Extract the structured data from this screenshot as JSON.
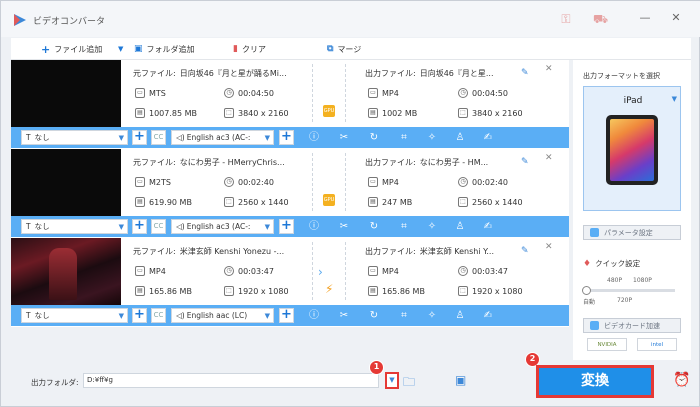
{
  "app": {
    "title": "ビデオコンバータ"
  },
  "toolbar": {
    "add_file": "ファイル追加",
    "add_folder": "フォルダ追加",
    "clear": "クリア",
    "merge": "マージ"
  },
  "labels": {
    "source": "元ファイル:",
    "output": "出力ファイル:"
  },
  "items": [
    {
      "src_name": "日向坂46『月と星が踊るMi...",
      "src_format": "MTS",
      "src_duration": "00:04:50",
      "src_size": "1007.85 MB",
      "src_res": "3840 x 2160",
      "out_name": "日向坂46『月と星...",
      "out_format": "MP4",
      "out_duration": "00:04:50",
      "out_size": "1002 MB",
      "out_res": "3840 x 2160",
      "subtitle": "なし",
      "audio": "English ac3 (AC-:",
      "accel": "GPU"
    },
    {
      "src_name": "なにわ男子 - HMerryChris...",
      "src_format": "M2TS",
      "src_duration": "00:02:40",
      "src_size": "619.90 MB",
      "src_res": "2560 x 1440",
      "out_name": "なにわ男子 - HM...",
      "out_format": "MP4",
      "out_duration": "00:02:40",
      "out_size": "247 MB",
      "out_res": "2560 x 1440",
      "subtitle": "なし",
      "audio": "English ac3 (AC-:",
      "accel": "GPU"
    },
    {
      "src_name": "米津玄師 Kenshi Yonezu -...",
      "src_format": "MP4",
      "src_duration": "00:03:47",
      "src_size": "165.86 MB",
      "src_res": "1920 x 1080",
      "out_name": "米津玄師 Kenshi Y...",
      "out_format": "MP4",
      "out_duration": "00:03:47",
      "out_size": "165.86 MB",
      "out_res": "1920 x 1080",
      "subtitle": "なし",
      "audio": "English aac (LC)",
      "accel": "fast"
    }
  ],
  "right_panel": {
    "format_label": "出力フォーマットを選択",
    "device": "iPad",
    "param_button": "パラメータ設定",
    "quality_label": "クイック設定",
    "quality_ticks": {
      "t480": "480P",
      "t1080": "1080P",
      "auto": "自動",
      "t720": "720P"
    },
    "quality_level": "自動",
    "hw_button": "ビデオカード加速",
    "nvidia": "NVIDIA",
    "intel": "intel"
  },
  "bottom": {
    "folder_label": "出力フォルダ:",
    "folder_value": "D:¥ff¥g",
    "convert": "変換",
    "badge1": "1",
    "badge2": "2"
  },
  "colors": {
    "accent": "#5aaef5",
    "convert": "#1f8fe8",
    "highlight": "#e53935"
  }
}
